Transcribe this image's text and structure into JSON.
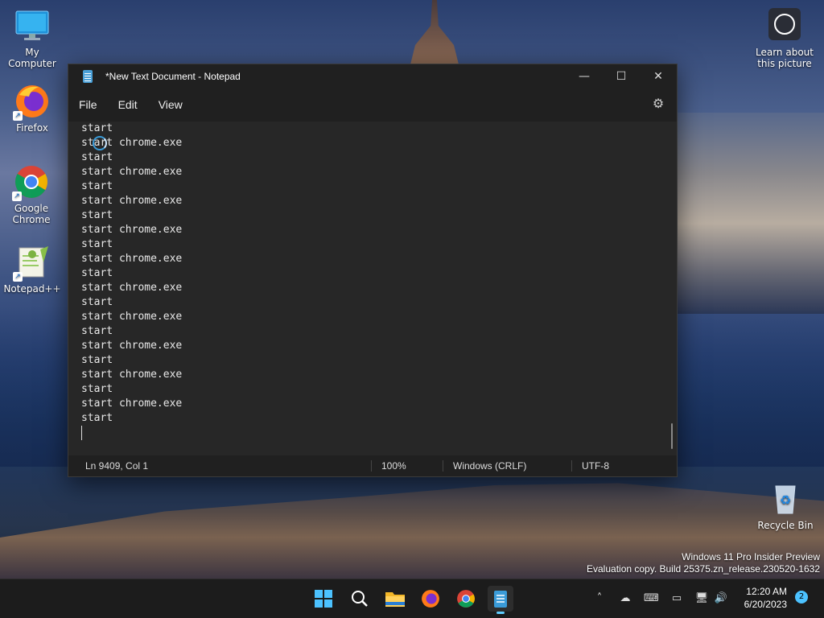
{
  "desktop": {
    "icons": [
      {
        "label": "My Computer"
      },
      {
        "label": "Firefox"
      },
      {
        "label": "Google Chrome"
      },
      {
        "label": "Notepad++"
      },
      {
        "label": "Recycle Bin"
      }
    ],
    "learn_picture": "Learn about this picture",
    "watermark": {
      "line1": "Windows 11 Pro Insider Preview",
      "line2": "Evaluation copy. Build 25375.zn_release.230520-1632"
    }
  },
  "notepad": {
    "title": "*New Text Document - Notepad",
    "menu": [
      "File",
      "Edit",
      "View"
    ],
    "lines": [
      "start",
      "start chrome.exe",
      "start",
      "start chrome.exe",
      "start",
      "start chrome.exe",
      "start",
      "start chrome.exe",
      "start",
      "start chrome.exe",
      "start",
      "start chrome.exe",
      "start",
      "start chrome.exe",
      "start",
      "start chrome.exe",
      "start",
      "start chrome.exe",
      "start",
      "start chrome.exe",
      "start"
    ],
    "status": {
      "position": "Ln 9409, Col 1",
      "zoom": "100%",
      "line_ending": "Windows (CRLF)",
      "encoding": "UTF-8"
    }
  },
  "taskbar": {
    "apps": [
      "start-icon",
      "search-icon",
      "file-explorer-icon",
      "firefox-icon",
      "chrome-icon",
      "notepad-icon"
    ],
    "time": "12:20 AM",
    "date": "6/20/2023",
    "notification_count": "2"
  }
}
